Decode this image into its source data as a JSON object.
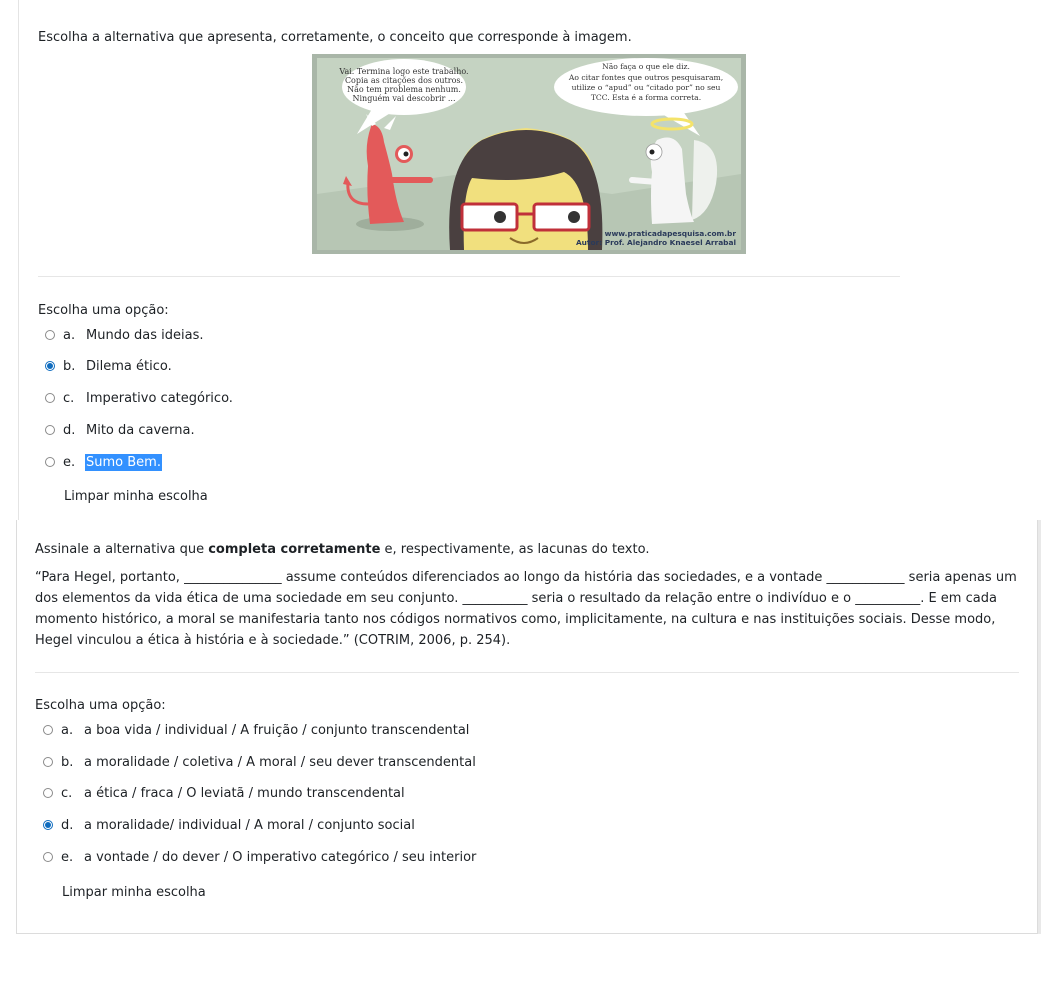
{
  "question1": {
    "text": "Escolha a alternativa que apresenta, corretamente, o conceito que corresponde à imagem.",
    "cartoon": {
      "left_bubble": [
        "Vai. Termina logo este trabalho.",
        "Copia as citações dos outros.",
        "Não tem problema nenhum.",
        "Ninguém vai descobrir ..."
      ],
      "right_bubble": [
        "Não faça o que ele diz.",
        "Ao citar fontes que outros pesquisaram,",
        "utilize o “apud” ou “citado por” no seu",
        "TCC. Esta é a forma correta."
      ],
      "credit_url": "www.praticadapesquisa.com.br",
      "credit_author": "Autor: Prof. Alejandro Knaesel Arrabal"
    },
    "prompt": "Escolha uma opção:",
    "options": [
      {
        "letter": "a.",
        "text": "Mundo das ideias.",
        "checked": false
      },
      {
        "letter": "b.",
        "text": "Dilema ético.",
        "checked": true
      },
      {
        "letter": "c.",
        "text": "Imperativo categórico.",
        "checked": false
      },
      {
        "letter": "d.",
        "text": "Mito da caverna.",
        "checked": false
      },
      {
        "letter": "e.",
        "text": "Sumo Bem.",
        "checked": false
      }
    ],
    "clear": "Limpar minha escolha"
  },
  "question2": {
    "instruction_before": "Assinale a alternativa que ",
    "instruction_bold": "completa corretamente",
    "instruction_after": " e, respectivamente, as lacunas do texto.",
    "quote": "“Para Hegel, portanto, _______________ assume conteúdos diferenciados ao longo da história das sociedades, e a vontade ____________ seria apenas um dos elementos da vida ética de uma sociedade em seu conjunto. __________ seria o resultado da relação entre o indivíduo e o __________. E em cada momento histórico, a moral se manifestaria tanto nos códigos normativos como, implicitamente, na cultura e nas instituições sociais. Desse modo, Hegel vinculou a ética à história e à sociedade.” (COTRIM, 2006, p. 254).",
    "prompt": "Escolha uma opção:",
    "options": [
      {
        "letter": "a.",
        "text": "a boa vida / individual / A fruição / conjunto transcendental",
        "checked": false
      },
      {
        "letter": "b.",
        "text": "a moralidade / coletiva / A moral / seu dever transcendental",
        "checked": false
      },
      {
        "letter": "c.",
        "text": "a ética / fraca / O leviatã / mundo transcendental",
        "checked": false
      },
      {
        "letter": "d.",
        "text": "a moralidade/ individual / A moral / conjunto social",
        "checked": true
      },
      {
        "letter": "e.",
        "text": "a vontade / do dever / O imperativo categórico / seu interior",
        "checked": false
      }
    ],
    "clear": "Limpar minha escolha"
  },
  "colors": {
    "accent": "#0f6cbf",
    "selection": "#3391ff"
  }
}
